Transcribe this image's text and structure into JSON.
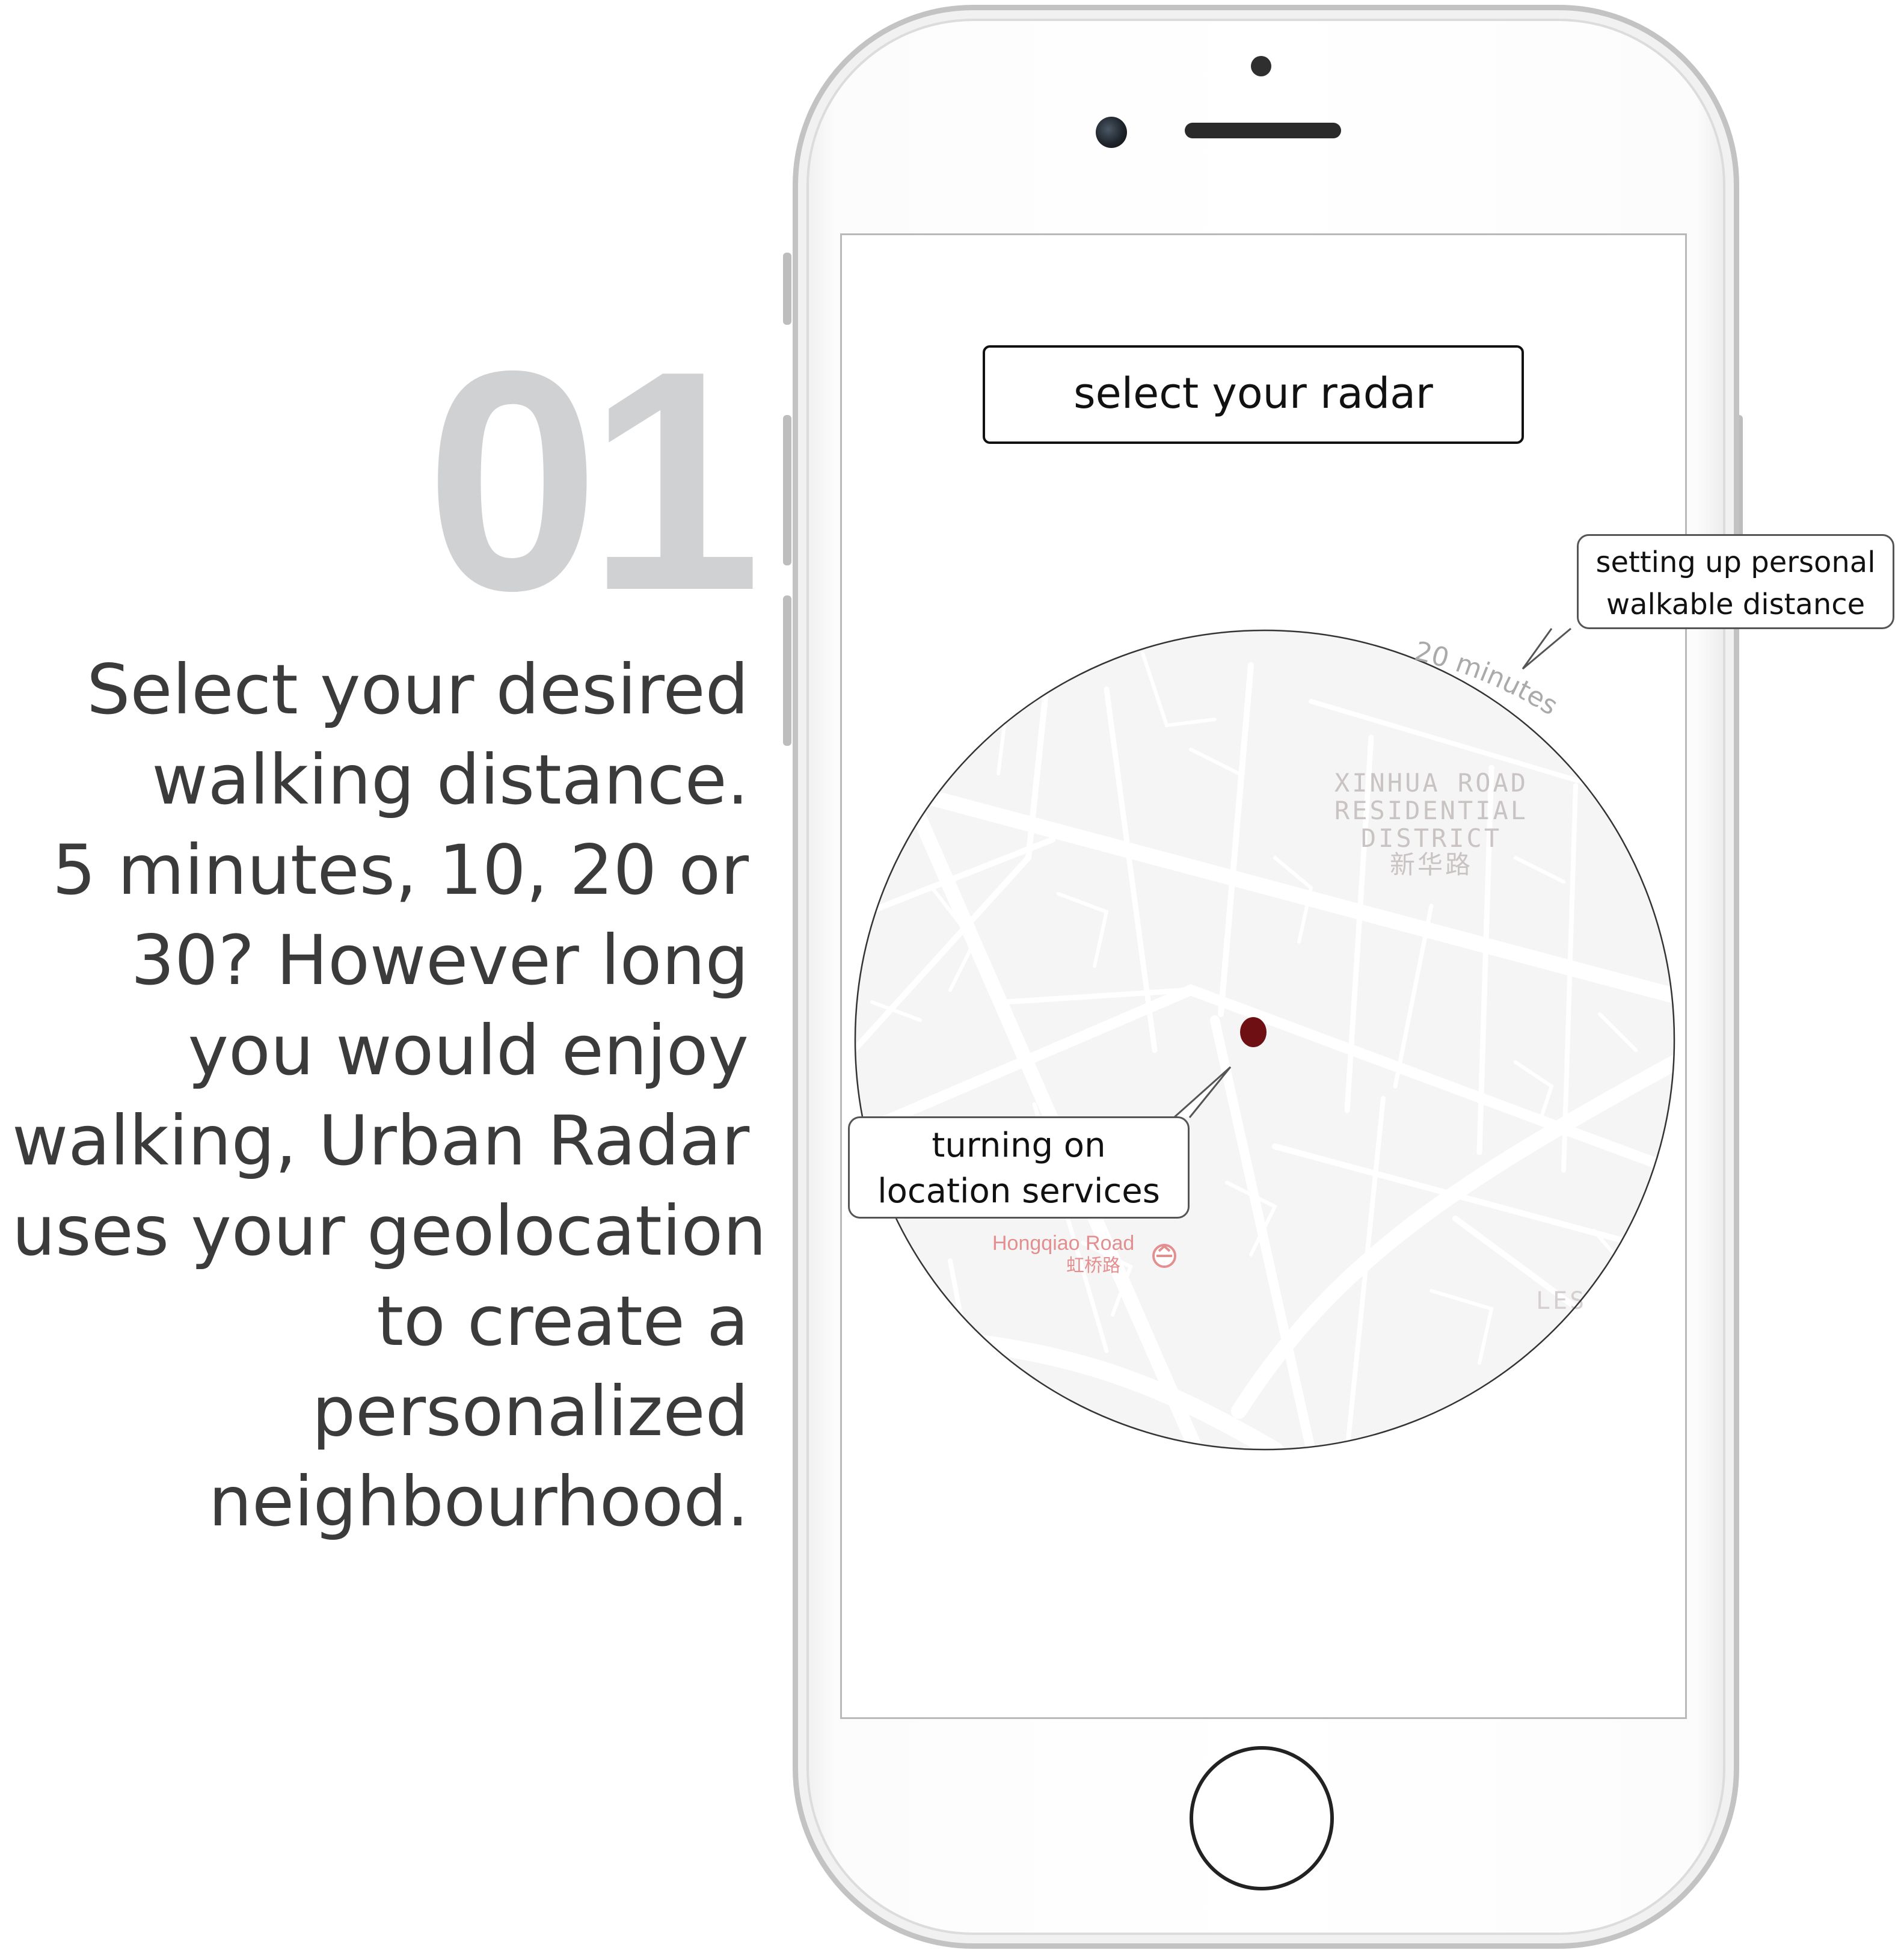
{
  "step": {
    "number": "01",
    "description_lines": [
      "Select your desired",
      "walking distance.",
      "5 minutes, 10, 20 or",
      "30? However long",
      "you would enjoy",
      "walking, Urban Radar",
      "uses your geolocation",
      "to create a",
      "personalized",
      "neighbourhood."
    ]
  },
  "app": {
    "radar_button_label": "select your radar",
    "radar": {
      "ring_label": "20 minutes",
      "district_label": [
        "XINHUA ROAD",
        "RESIDENTIAL",
        "DISTRICT",
        "新华路"
      ],
      "station_name": "Hongqiao Road",
      "station_name_cn": "虹桥路",
      "edge_label": "LES"
    }
  },
  "callouts": {
    "walkable": [
      "setting up personal",
      "walkable distance"
    ],
    "location": [
      "turning on",
      "location services"
    ]
  },
  "colors": {
    "step_number": "#d0d1d3",
    "body_text": "#3b3b3b",
    "map_background": "#f6f5f5",
    "map_roads": "#ffffff",
    "location_dot": "#6e0f14",
    "map_label": "#c9c3c3",
    "metro_label": "#e38f8f"
  }
}
